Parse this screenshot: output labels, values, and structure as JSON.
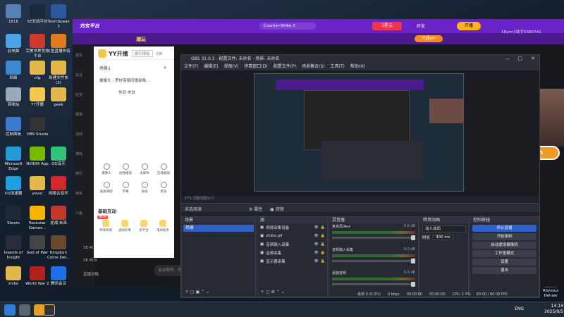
{
  "desktop": {
    "icons": [
      {
        "label": "1818",
        "color": "#5a7fb2"
      },
      {
        "label": "5E对战平台",
        "color": "#1b2a3b"
      },
      {
        "label": "TeamSpeak 3",
        "color": "#2a5a9a"
      },
      {
        "label": "此电脑",
        "color": "#4da3e8"
      },
      {
        "label": "完美世界竞技平台",
        "color": "#d0392b"
      },
      {
        "label": "斗鱼直播伴侣",
        "color": "#e07a1f"
      },
      {
        "label": "网络",
        "color": "#3a88d0"
      },
      {
        "label": "cfg",
        "color": "#e3b84a"
      },
      {
        "label": "新建文件夹 (3)",
        "color": "#e3b84a"
      },
      {
        "label": "回收站",
        "color": "#9ab"
      },
      {
        "label": "YY开播",
        "color": "#f2c94c"
      },
      {
        "label": "geek",
        "color": "#e3b84a"
      },
      {
        "label": "控制面板",
        "color": "#3b7ad0"
      },
      {
        "label": "OBS Studio",
        "color": "#333"
      },
      {
        "label": "Microsoft Edge",
        "color": "#1f9bd7"
      },
      {
        "label": "NVIDIA App",
        "color": "#76b900"
      },
      {
        "label": "QQ音乐",
        "color": "#31c27c"
      },
      {
        "label": "UU加速器",
        "color": "#20a0e0"
      },
      {
        "label": "youxi",
        "color": "#e3b84a"
      },
      {
        "label": "网易云音乐",
        "color": "#d1292b"
      },
      {
        "label": "Steam",
        "color": "#1b2838"
      },
      {
        "label": "Rockstar Games...",
        "color": "#f4b400"
      },
      {
        "label": "逆战:未来",
        "color": "#c0392b"
      },
      {
        "label": "Islands of Insight",
        "color": "#2b2b3b"
      },
      {
        "label": "God of War",
        "color": "#444"
      },
      {
        "label": "Kingdom Come Del...",
        "color": "#6b4a2a"
      },
      {
        "label": "zhibo",
        "color": "#e3b84a"
      },
      {
        "label": "World War Z",
        "color": "#b02020"
      },
      {
        "label": "腾讯会议",
        "color": "#1f6fe8"
      }
    ],
    "right_icon": {
      "label": "Abyssus Deluxe"
    }
  },
  "platform": {
    "brand": "刘玄平台",
    "streamer_name": "Counter-Strike 2",
    "wave": "潮玩",
    "btn_shop": "5星元",
    "btn_friend": "好友",
    "btn_open": "开播",
    "btn_vip": "开通VIP",
    "chat_placeholder": "说点啥吧，开启...",
    "chat_user": "18ym小助手5380741",
    "sidebar": [
      "首页",
      "关注",
      "社交",
      "赛事",
      "活动",
      "游戏",
      "排行",
      "榜单",
      "斗鱼"
    ],
    "bottom": [
      "SE Ai",
      "SE BOX",
      "直播看",
      "直播攻略"
    ]
  },
  "yy": {
    "title": "YY开播",
    "mode": "娱乐模板",
    "switch": "切换",
    "scene_label": "场景1",
    "source_label": "摄像头 - 罗技简易同播录像...",
    "source_sub": "美颜-美肤",
    "tools": [
      "摄像头",
      "视频播放",
      "多媒体",
      "区域截图",
      "截屏捕捉",
      "字幕",
      "贴纸",
      "更多"
    ],
    "interact_title": "基础互动",
    "interact": [
      "特效商城",
      "虚拟形象",
      "多平台",
      "电商助手"
    ],
    "badge_new": "NEW"
  },
  "obs": {
    "title": "OBS 31.0.3 - 配置文件: 未命名 - 场景: 未命名",
    "menu": [
      "文件(F)",
      "编辑(E)",
      "视图(V)",
      "停靠窗口(D)",
      "配置文件(P)",
      "场景集合(S)",
      "工具(T)",
      "帮助(H)"
    ],
    "zoom": "37% 调整视图大小",
    "no_source": "未选择源",
    "btn_props": "属性",
    "btn_filters": "滤镜",
    "scenes_hd": "场景",
    "scenes": [
      "场景"
    ],
    "sources_hd": "源",
    "sources": [
      "视频采集设备",
      "zhibo.gif",
      "音频输入采集",
      "音频采集",
      "显示器采集"
    ],
    "mixer_hd": "混音器",
    "mixer": [
      {
        "name": "麦克风/Aux",
        "db": "0.0 dB"
      },
      {
        "name": "音频输入采集",
        "db": "0.0 dB"
      },
      {
        "name": "桌面音频",
        "db": "0.0 dB"
      }
    ],
    "meter_scale": "-60 -55 -50 -45 -40 -35 -30 -25 -20 -15 -10 -5 0",
    "trans_hd": "转场动画",
    "trans_select": "淡入淡出",
    "duration_label": "时长",
    "duration": "300 ms",
    "ctrl_hd": "控制按钮",
    "controls": [
      "停止直播",
      "开始录制",
      "启动虚拟摄像机",
      "工作室模式",
      "设置",
      "退出"
    ],
    "status_frames": "丢帧 0 (0.0%)",
    "status_kbps": "0 kbps",
    "status_t1": "00:00:00",
    "status_t2": "00:00:00",
    "status_cpu": "CPU: 1.5%",
    "status_fps": "60.00 / 60.00 FPS"
  },
  "overlay": {
    "name": "love18ym"
  },
  "taskbar": {
    "time": "14:14",
    "date": "2025/9/5",
    "lang": "ENG",
    "apps": [
      "windows",
      "search",
      "cs2",
      "goose",
      "obs"
    ]
  }
}
